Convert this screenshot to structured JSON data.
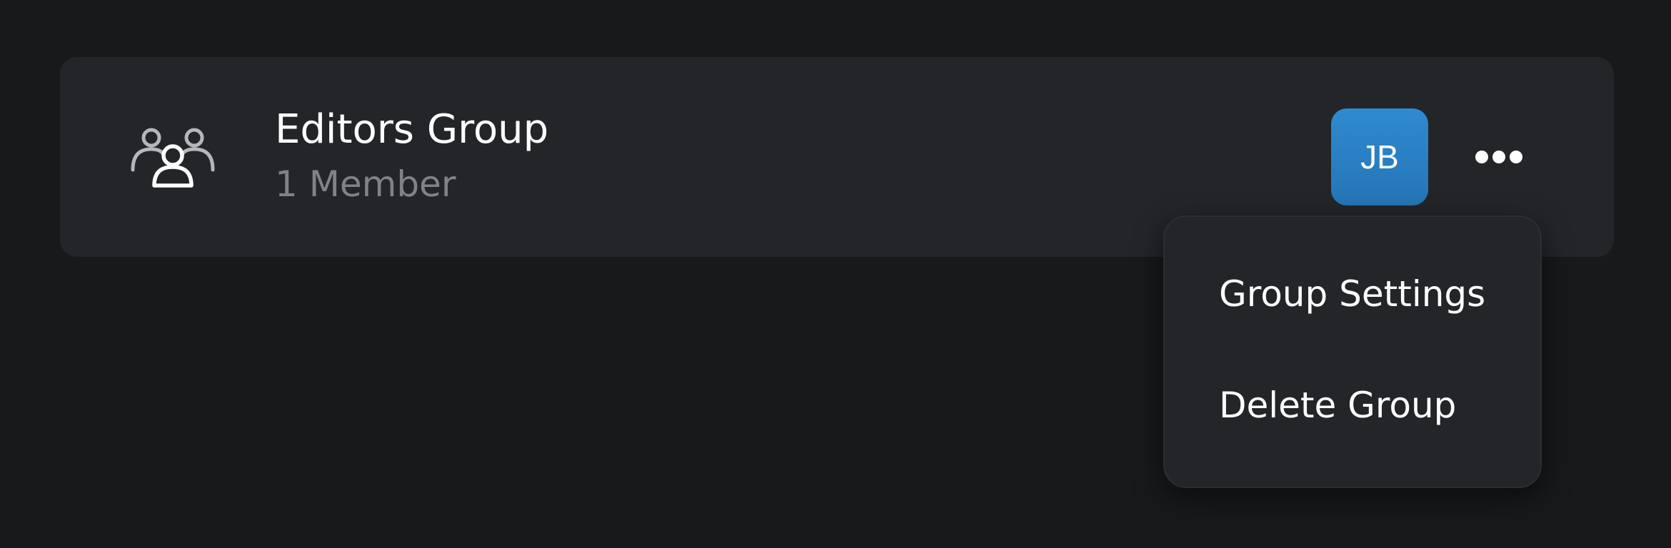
{
  "group": {
    "name": "Editors Group",
    "member_count": "1 Member",
    "icon": "users-group-icon"
  },
  "members": [
    {
      "initials": "JB",
      "color": "#2a80c4"
    }
  ],
  "actions": {
    "more_icon": "more-horizontal-icon"
  },
  "menu": {
    "items": [
      {
        "label": "Group Settings"
      },
      {
        "label": "Delete Group"
      }
    ]
  },
  "colors": {
    "background": "#18191b",
    "card": "#232529",
    "accent": "#2a80c4",
    "muted_text": "#7f8388"
  }
}
